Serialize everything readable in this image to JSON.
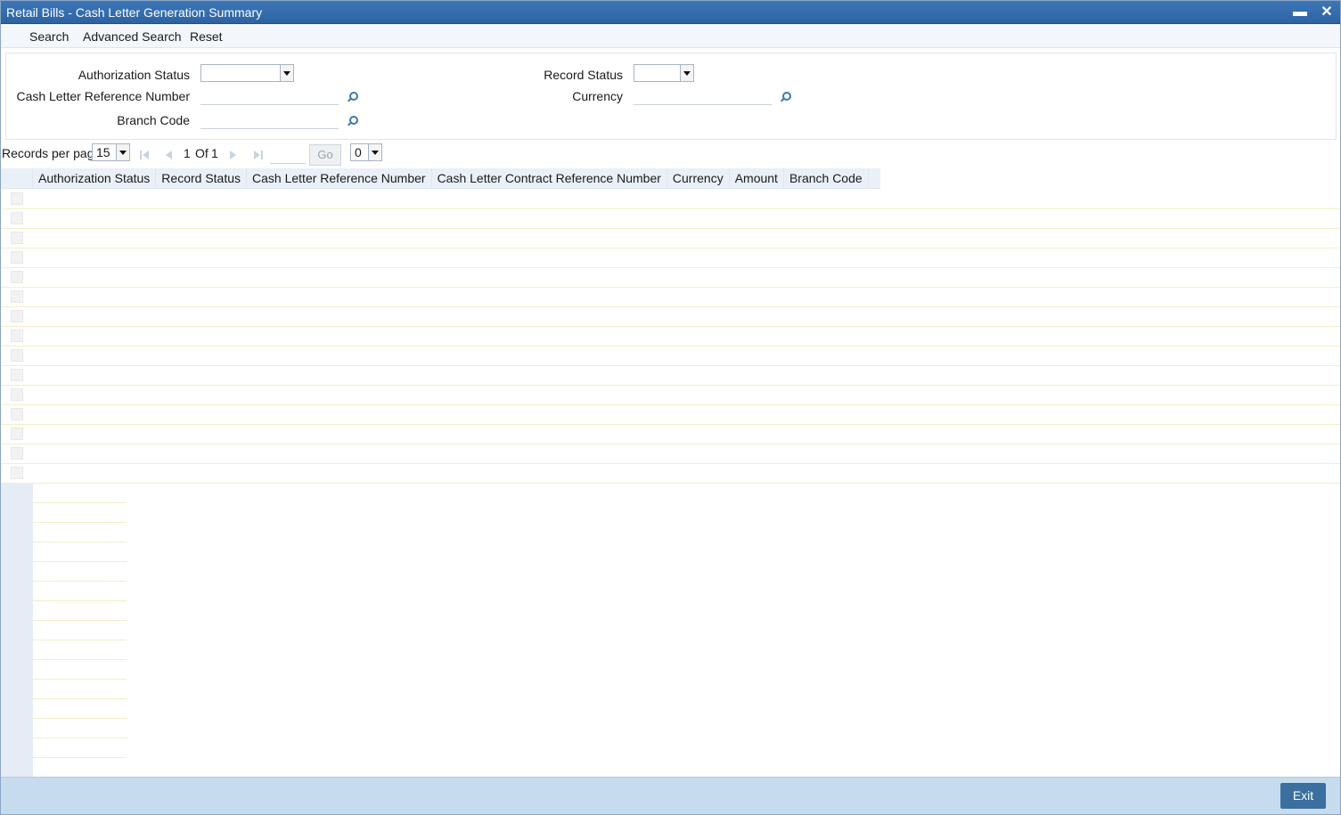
{
  "window": {
    "title": "Retail Bills - Cash Letter Generation Summary",
    "minimize_glyph": "▬",
    "close_glyph": "✕"
  },
  "toolbar": {
    "search": "Search",
    "advanced_search": "Advanced Search",
    "reset": "Reset"
  },
  "criteria": {
    "authorization_status": {
      "label": "Authorization Status",
      "value": ""
    },
    "record_status": {
      "label": "Record Status",
      "value": ""
    },
    "cash_letter_ref": {
      "label": "Cash Letter Reference Number",
      "value": ""
    },
    "currency": {
      "label": "Currency",
      "value": ""
    },
    "branch_code": {
      "label": "Branch Code",
      "value": ""
    }
  },
  "pager": {
    "records_per_page_label": "Records per page",
    "records_per_page": "15",
    "current_page": "1",
    "of_label": "Of",
    "total_pages": "1",
    "go_label": "Go",
    "extra_select": "0"
  },
  "grid": {
    "columns": [
      "Authorization Status",
      "Record Status",
      "Cash Letter Reference Number",
      "Cash Letter Contract Reference Number",
      "Currency",
      "Amount",
      "Branch Code"
    ]
  },
  "footer": {
    "exit": "Exit"
  },
  "colors": {
    "titlebar": "#2d63a3",
    "footer": "#c6dcee",
    "exit_button": "#3a6f9f"
  }
}
